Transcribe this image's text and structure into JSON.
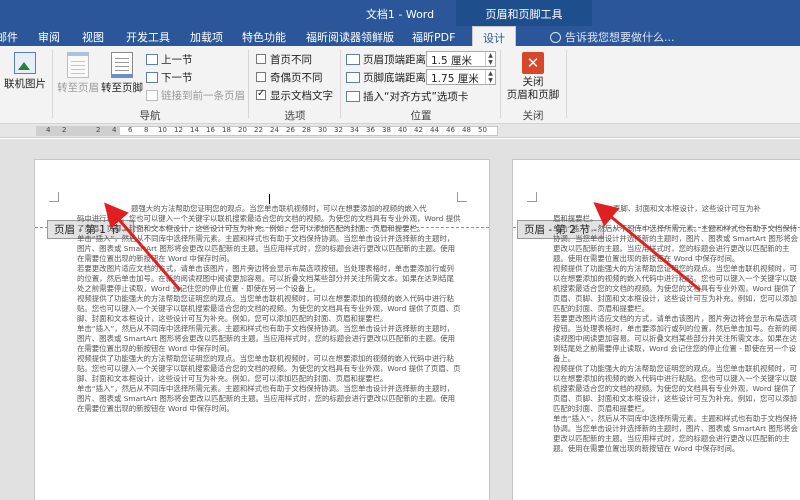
{
  "title_bar": {
    "doc_title": "文档1 - Word",
    "context_title": "页眉和页脚工具"
  },
  "tabs": [
    "邮件",
    "审阅",
    "视图",
    "开发工具",
    "加载项",
    "特色功能",
    "福昕阅读器领鲜版",
    "福昕PDF",
    "设计"
  ],
  "active_tab": "设计",
  "tell_me": "告诉我您想要做什么...",
  "ribbon": {
    "insert_group": {
      "online_picture": "联机图片"
    },
    "nav_group": {
      "label": "导航",
      "goto_header": "转至页眉",
      "goto_footer": "转至页脚",
      "prev_section": "上一节",
      "next_section": "下一节",
      "link_to_prev": "链接到前一条页眉"
    },
    "options_group": {
      "label": "选项",
      "diff_first": "首页不同",
      "diff_odd_even": "奇偶页不同",
      "show_doc_text": "显示文档文字",
      "checked": [
        false,
        false,
        true
      ]
    },
    "position_group": {
      "label": "位置",
      "header_top_label": "页眉顶端距离:",
      "header_top_value": "1.5 厘米",
      "footer_bottom_label": "页脚底端距离:",
      "footer_bottom_value": "1.75 厘米",
      "insert_align_tab": "插入“对齐方式”选项卡"
    },
    "close_group": {
      "label": "关闭",
      "close_line1": "关闭",
      "close_line2": "页眉和页脚"
    }
  },
  "ruler": {
    "numbers": [
      "4",
      "2",
      "2",
      "4",
      "6",
      "8",
      "10",
      "12",
      "14",
      "16",
      "18",
      "20",
      "22",
      "24",
      "26",
      "28",
      "30",
      "32",
      "34",
      "36",
      "38",
      "40",
      "42",
      "44",
      "46",
      "48",
      "50"
    ]
  },
  "pages": [
    {
      "header_tag": "页眉 - 第 1 节 -",
      "first_line": "题强大的方法帮助您证明您的观点。当您单击联机视频时，可以在想要添加的视频的嵌入代",
      "paragraphs": [
        "码中进行粘贴。您也可以键入一个关键字以联机搜索最适合您的文档的视频。为使您的文档具有专业外观，Word 提供了页眉、页脚、封面和文本框设计，这些设计可互为补充。例如，您可以添加匹配的封面、页眉和提要栏。",
        "单击“插入”，然后从不同库中选择所需元素。主题和样式也有助于文档保持协调。当您单击设计并选择新的主题时，图片、图表或 SmartArt 图形将会更改以匹配新的主题。当应用样式时，您的标题会进行更改以匹配新的主题。使用在需要位置出现的新按钮在 Word 中保存时间。",
        "若要更改图片适应文档的方式，请单击该图片，图片旁边将会显示布局选项按钮。当处理表格时，单击要添加行或列的位置，然后单击加号。在新的阅读视图中阅读更加容易。可以折叠文档某些部分并关注所需文本。如果在达到结尾处之前需要停止读取，Word 会记住您的停止位置 - 即使在另一个设备上。",
        "视频提供了功能强大的方法帮助您证明您的观点。当您单击联机视频时，可以在想要添加的视频的嵌入代码中进行粘贴。您也可以键入一个关键字以联机搜索最适合您的文档的视频。为使您的文档具有专业外观，Word 提供了页眉、页脚、封面和文本框设计，这些设计可互为补充。例如，您可以添加匹配的封面、页眉和提要栏。",
        "单击“插入”，然后从不同库中选择所需元素。主题和样式也有助于文档保持协调。当您单击设计并选择新的主题时，图片、图表或 SmartArt 图形将会更改以匹配新的主题。当应用样式时，您的标题会进行更改以匹配新的主题。使用在需要位置出现的新按钮在 Word 中保存时间。",
        "视频提供了功能强大的方法帮助您证明您的观点。当您单击联机视频时，可以在想要添加的视频的嵌入代码中进行粘贴。您也可以键入一个关键字以联机搜索最适合您的文档的视频。为使您的文档具有专业外观，Word 提供了页眉、页脚、封面和文本框设计，这些设计可互为补充。例如，您可以添加匹配的封面、页眉和提要栏。",
        "单击“插入”，然后从不同库中选择所需元素。主题和样式也有助于文档保持协调。当您单击设计并选择新的主题时，图片、图表或 SmartArt 图形将会更改以匹配新的主题。当应用样式时，您的标题会进行更改以匹配新的主题。使用在需要位置出现的新按钮在 Word 中保存时间。"
      ]
    },
    {
      "header_tag": "页眉 - 第 2 节 -",
      "first_line": "页脚、封面和文本框设计，这些设计可互为补",
      "paragraphs": [
        "眉和提要栏。",
        "单击“插入”，然后从不同库中选择所需元素。主题和样式也有助于文档保持协调。当您单击设计并选择新的主题时，图片、图表或 SmartArt 图形将会更改以匹配新的主题。当应用样式时，您的标题会进行更改以匹配新的主题。使用在需要位置出现的新按钮在 Word 中保存时间。",
        "视频提供了功能强大的方法帮助您证明您的观点。当您单击联机视频时，可以在想要添加的视频的嵌入代码中进行粘贴。您也可以键入一个关键字以联机搜索最适合您的文档的视频。为使您的文档具有专业外观，Word 提供了页眉、页脚、封面和文本框设计，这些设计可互为补充。例如，您可以添加匹配的封面、页眉和提要栏。",
        "若要更改图片适应文档的方式，请单击该图片，图片旁边将会显示布局选项按钮。当处理表格时，单击要添加行或列的位置，然后单击加号。在新的阅读视图中阅读更加容易。可以折叠文档某些部分并关注所需文本。如果在达到结尾处之前需要停止读取，Word 会记住您的停止位置 - 即使在另一个设备上。",
        "视频提供了功能强大的方法帮助您证明您的观点。当您单击联机视频时，可以在想要添加的视频的嵌入代码中进行粘贴。您也可以键入一个关键字以联机搜索最适合您的文档的视频。为使您的文档具有专业外观，Word 提供了页眉、页脚、封面和文本框设计，这些设计可互为补充。例如，您可以添加匹配的封面、页眉和提要栏。",
        "单击“插入”，然后从不同库中选择所需元素。主题和样式也有助于文档保持协调。当您单击设计并选择新的主题时，图片、图表或 SmartArt 图形将会更改以匹配新的主题。当应用样式时，您的标题会进行更改以匹配新的主题。使用在需要位置出现的新按钮在 Word 中保存时间。"
      ]
    }
  ],
  "colors": {
    "word_blue": "#2b579a",
    "annotation_red": "#e02020",
    "close_red": "#d9472b"
  }
}
